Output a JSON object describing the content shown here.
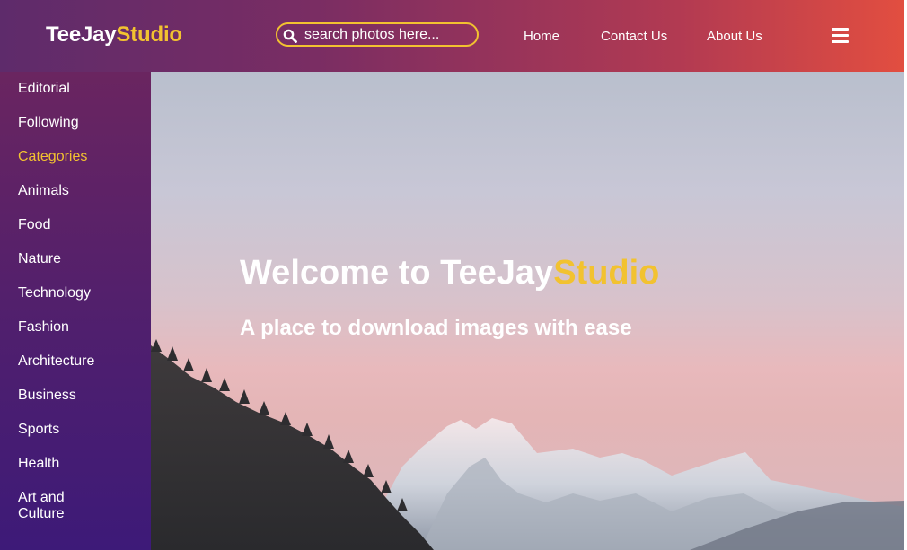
{
  "brand": {
    "name_part1": "TeeJay",
    "name_part2": "Studio",
    "accent_color": "#f2c230"
  },
  "search": {
    "placeholder": "search photos here...",
    "icon": "search-icon"
  },
  "nav": {
    "home": "Home",
    "contact": "Contact Us",
    "about": "About Us",
    "menu_icon": "hamburger-menu-icon"
  },
  "sidebar": {
    "items": [
      {
        "label": "Editorial"
      },
      {
        "label": "Following"
      },
      {
        "label": "Categories",
        "active": true
      },
      {
        "label": "Animals"
      },
      {
        "label": "Food"
      },
      {
        "label": "Nature"
      },
      {
        "label": "Technology"
      },
      {
        "label": "Fashion"
      },
      {
        "label": "Architecture"
      },
      {
        "label": "Business"
      },
      {
        "label": "Sports"
      },
      {
        "label": "Health"
      },
      {
        "label": "Art and Culture"
      }
    ]
  },
  "hero": {
    "title_part1": "Welcome to TeeJay",
    "title_part2": "Studio",
    "subtitle": "A place to download images with ease",
    "image": "snowy-mountain-landscape"
  }
}
